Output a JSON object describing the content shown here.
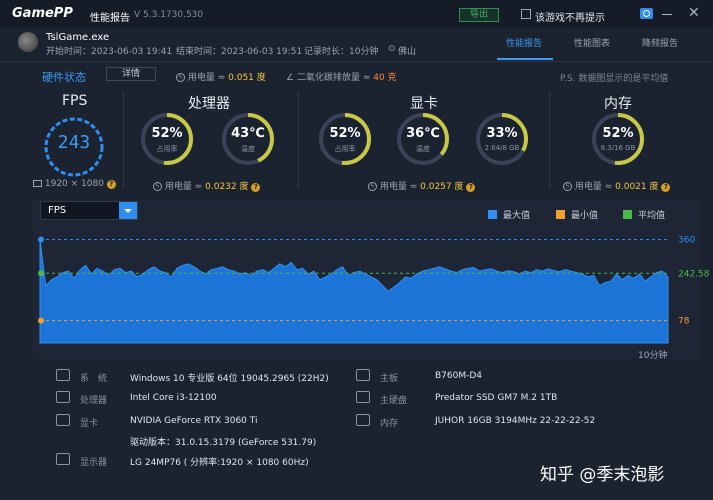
{
  "titlebar": {
    "logo": "GamePP",
    "title": "性能报告",
    "version": "V 5.3.1730.530",
    "export_label": "导出",
    "checkbox_label": "该游戏不再提示"
  },
  "session": {
    "game_name": "TslGame.exe",
    "start_time": "开始时间：2023-06-03 19:41",
    "end_time": "结束时间：2023-06-03 19:51",
    "duration": "记录时长：10分钟",
    "location": "佛山"
  },
  "tabs": [
    {
      "label": "性能报告",
      "active": true
    },
    {
      "label": "性能图表",
      "active": false
    },
    {
      "label": "降频报告",
      "active": false
    }
  ],
  "status": {
    "title": "硬件状态",
    "detail_label": "详情",
    "power_label": "用电量 ≈ ",
    "power_value": "0.051 度",
    "co2_label": "二氧化碳排放量 ≈ ",
    "co2_value": "40 克",
    "ps_note": "P.S. 数据图显示的是平均值"
  },
  "fps": {
    "title": "FPS",
    "value": "243",
    "resolution": "1920 × 1080"
  },
  "cpu": {
    "title": "处理器",
    "usage_value": "52%",
    "usage_label": "占用率",
    "usage_level": 0.52,
    "temp_value": "43℃",
    "temp_label": "温度",
    "temp_level": 0.43,
    "power_label": "用电量 ≈ ",
    "power_value": "0.0232 度"
  },
  "gpu": {
    "title": "显卡",
    "usage_value": "52%",
    "usage_label": "占用率",
    "usage_level": 0.52,
    "temp_value": "36℃",
    "temp_label": "温度",
    "temp_level": 0.36,
    "vram_value": "33%",
    "vram_label": "2.64/8 GB",
    "vram_level": 0.33,
    "power_label": "用电量 ≈ ",
    "power_value": "0.0257 度"
  },
  "memory": {
    "title": "内存",
    "usage_value": "52%",
    "usage_label": "8.3/16 GB",
    "usage_level": 0.52,
    "power_label": "用电量 ≈ ",
    "power_value": "0.0021 度"
  },
  "chart_select": "FPS",
  "legend": [
    {
      "label": "最大值",
      "color": "#2f8ff0"
    },
    {
      "label": "最小值",
      "color": "#f0a030"
    },
    {
      "label": "平均值",
      "color": "#4bb84b"
    }
  ],
  "chart_data": {
    "type": "area",
    "x_label": "10分钟",
    "max_label": "360",
    "avg_label": "242.58",
    "min_label": "78",
    "ylim": [
      0,
      400
    ],
    "max_value": 360,
    "avg_value": 242.58,
    "min_value": 78,
    "values": [
      360,
      200,
      220,
      230,
      245,
      250,
      225,
      255,
      270,
      240,
      260,
      250,
      235,
      255,
      260,
      245,
      250,
      230,
      240,
      255,
      265,
      250,
      245,
      230,
      260,
      270,
      275,
      265,
      250,
      240,
      255,
      260,
      265,
      255,
      250,
      240,
      245,
      235,
      250,
      255,
      245,
      260,
      275,
      265,
      280,
      255,
      260,
      240,
      250,
      220,
      230,
      240,
      255,
      265,
      235,
      245,
      250,
      240,
      230,
      220,
      200,
      180,
      195,
      210,
      230,
      225,
      240,
      250,
      255,
      260,
      265,
      258,
      250,
      245,
      255,
      260,
      262,
      250,
      255,
      258,
      250,
      245,
      252,
      248,
      240,
      250,
      245,
      255,
      250,
      258,
      252,
      248,
      255,
      250,
      245,
      240,
      230,
      235,
      200,
      210,
      215,
      240,
      220,
      235,
      225,
      240,
      215,
      230,
      245,
      250,
      230
    ]
  },
  "system": {
    "os_label": "系　统",
    "os_value": "Windows 10 专业版 64位 19045.2965 (22H2)",
    "cpu_label": "处理器",
    "cpu_value": "Intel Core i3-12100",
    "gpu_label": "显卡",
    "gpu_value": "NVIDIA GeForce RTX 3060 Ti",
    "driver_value": "驱动版本：31.0.15.3179 (GeForce 531.79)",
    "monitor_label": "显示器",
    "monitor_value": "LG 24MP76 ( 分辨率:1920 × 1080 60Hz)",
    "board_label": "主板",
    "board_value": "B760M-D4",
    "disk_label": "主硬盘",
    "disk_value": "Predator SSD GM7 M.2 1TB",
    "mem_label": "内存",
    "mem_value": "JUHOR 16GB 3194MHz 22-22-22-52"
  },
  "watermark": "知乎 @季末泡影"
}
